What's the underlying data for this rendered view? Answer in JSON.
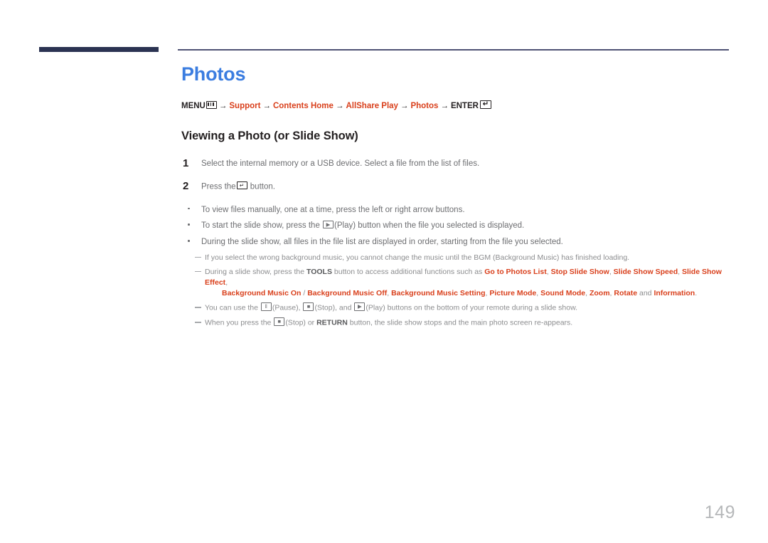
{
  "document": {
    "page_title": "Photos",
    "page_number": "149",
    "accent_blue": "#3b7de0",
    "accent_orange": "#d9401c",
    "rule_navy": "#2b3352"
  },
  "breadcrumb": {
    "menu_label": "MENU",
    "menu_icon": "menu-key-icon",
    "arrow": "→",
    "items": [
      {
        "label": "Support",
        "accent": true
      },
      {
        "label": "Contents Home",
        "accent": true
      },
      {
        "label": "AllShare Play",
        "accent": true
      },
      {
        "label": "Photos",
        "accent": true
      }
    ],
    "enter_label": "ENTER",
    "enter_icon": "enter-key-icon"
  },
  "section": {
    "heading": "Viewing a Photo (or Slide Show)"
  },
  "steps": [
    {
      "num": "1",
      "text": "Select the internal memory or a USB device. Select a file from the list of files."
    },
    {
      "num": "2",
      "text_before": "Press the",
      "icon": "enter-key-icon",
      "text_after": "button."
    }
  ],
  "bullets": [
    {
      "text": "To view files manually, one at a time, press the left or right arrow buttons."
    },
    {
      "text_before": "To start the slide show, press the",
      "icon": "play-key-icon",
      "text_after": "(Play) button when the file you selected is displayed."
    },
    {
      "text": "During the slide show, all files in the file list are displayed in order, starting from the file you selected."
    }
  ],
  "notes": {
    "note1": "If you select the wrong background music, you cannot change the music until the BGM (Background Music) has finished loading.",
    "note2": {
      "lead": "During a slide show, press the",
      "bold_key": "TOOLS",
      "mid": "button to access additional functions such as",
      "menu_items_line1": [
        "Go to Photos List",
        "Stop Slide Show",
        "Slide Show Speed",
        "Slide Show Effect"
      ],
      "menu_items_line2": [
        "Background Music On",
        "Background Music Off",
        "Background Music Setting",
        "Picture Mode",
        "Sound Mode",
        "Zoom",
        "Rotate",
        "Information"
      ],
      "separator_slash": "/",
      "separator_comma": ",",
      "conjunction": "and",
      "terminator": "."
    },
    "note3": {
      "lead": "You can use the",
      "pause_label": "(Pause),",
      "stop_label": "(Stop), and",
      "play_label": "(Play) buttons on the bottom of your remote during a slide show."
    },
    "note4": {
      "lead": "When you press the",
      "stop_label": "(Stop) or",
      "bold_key": "RETURN",
      "tail": "button, the slide show stops and the main photo screen re-appears."
    }
  },
  "icons": {
    "menu": "menu-key-icon",
    "enter": "enter-key-icon",
    "play": "▶",
    "pause": "‖",
    "stop": "■"
  }
}
